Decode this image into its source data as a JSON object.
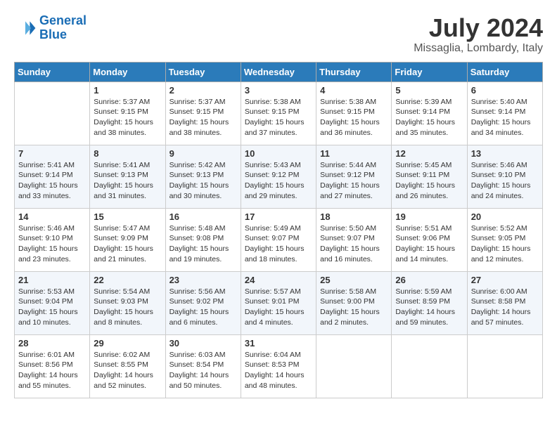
{
  "header": {
    "logo_line1": "General",
    "logo_line2": "Blue",
    "month_year": "July 2024",
    "location": "Missaglia, Lombardy, Italy"
  },
  "weekdays": [
    "Sunday",
    "Monday",
    "Tuesday",
    "Wednesday",
    "Thursday",
    "Friday",
    "Saturday"
  ],
  "weeks": [
    [
      {
        "day": "",
        "info": ""
      },
      {
        "day": "1",
        "info": "Sunrise: 5:37 AM\nSunset: 9:15 PM\nDaylight: 15 hours\nand 38 minutes."
      },
      {
        "day": "2",
        "info": "Sunrise: 5:37 AM\nSunset: 9:15 PM\nDaylight: 15 hours\nand 38 minutes."
      },
      {
        "day": "3",
        "info": "Sunrise: 5:38 AM\nSunset: 9:15 PM\nDaylight: 15 hours\nand 37 minutes."
      },
      {
        "day": "4",
        "info": "Sunrise: 5:38 AM\nSunset: 9:15 PM\nDaylight: 15 hours\nand 36 minutes."
      },
      {
        "day": "5",
        "info": "Sunrise: 5:39 AM\nSunset: 9:14 PM\nDaylight: 15 hours\nand 35 minutes."
      },
      {
        "day": "6",
        "info": "Sunrise: 5:40 AM\nSunset: 9:14 PM\nDaylight: 15 hours\nand 34 minutes."
      }
    ],
    [
      {
        "day": "7",
        "info": "Sunrise: 5:41 AM\nSunset: 9:14 PM\nDaylight: 15 hours\nand 33 minutes."
      },
      {
        "day": "8",
        "info": "Sunrise: 5:41 AM\nSunset: 9:13 PM\nDaylight: 15 hours\nand 31 minutes."
      },
      {
        "day": "9",
        "info": "Sunrise: 5:42 AM\nSunset: 9:13 PM\nDaylight: 15 hours\nand 30 minutes."
      },
      {
        "day": "10",
        "info": "Sunrise: 5:43 AM\nSunset: 9:12 PM\nDaylight: 15 hours\nand 29 minutes."
      },
      {
        "day": "11",
        "info": "Sunrise: 5:44 AM\nSunset: 9:12 PM\nDaylight: 15 hours\nand 27 minutes."
      },
      {
        "day": "12",
        "info": "Sunrise: 5:45 AM\nSunset: 9:11 PM\nDaylight: 15 hours\nand 26 minutes."
      },
      {
        "day": "13",
        "info": "Sunrise: 5:46 AM\nSunset: 9:10 PM\nDaylight: 15 hours\nand 24 minutes."
      }
    ],
    [
      {
        "day": "14",
        "info": "Sunrise: 5:46 AM\nSunset: 9:10 PM\nDaylight: 15 hours\nand 23 minutes."
      },
      {
        "day": "15",
        "info": "Sunrise: 5:47 AM\nSunset: 9:09 PM\nDaylight: 15 hours\nand 21 minutes."
      },
      {
        "day": "16",
        "info": "Sunrise: 5:48 AM\nSunset: 9:08 PM\nDaylight: 15 hours\nand 19 minutes."
      },
      {
        "day": "17",
        "info": "Sunrise: 5:49 AM\nSunset: 9:07 PM\nDaylight: 15 hours\nand 18 minutes."
      },
      {
        "day": "18",
        "info": "Sunrise: 5:50 AM\nSunset: 9:07 PM\nDaylight: 15 hours\nand 16 minutes."
      },
      {
        "day": "19",
        "info": "Sunrise: 5:51 AM\nSunset: 9:06 PM\nDaylight: 15 hours\nand 14 minutes."
      },
      {
        "day": "20",
        "info": "Sunrise: 5:52 AM\nSunset: 9:05 PM\nDaylight: 15 hours\nand 12 minutes."
      }
    ],
    [
      {
        "day": "21",
        "info": "Sunrise: 5:53 AM\nSunset: 9:04 PM\nDaylight: 15 hours\nand 10 minutes."
      },
      {
        "day": "22",
        "info": "Sunrise: 5:54 AM\nSunset: 9:03 PM\nDaylight: 15 hours\nand 8 minutes."
      },
      {
        "day": "23",
        "info": "Sunrise: 5:56 AM\nSunset: 9:02 PM\nDaylight: 15 hours\nand 6 minutes."
      },
      {
        "day": "24",
        "info": "Sunrise: 5:57 AM\nSunset: 9:01 PM\nDaylight: 15 hours\nand 4 minutes."
      },
      {
        "day": "25",
        "info": "Sunrise: 5:58 AM\nSunset: 9:00 PM\nDaylight: 15 hours\nand 2 minutes."
      },
      {
        "day": "26",
        "info": "Sunrise: 5:59 AM\nSunset: 8:59 PM\nDaylight: 14 hours\nand 59 minutes."
      },
      {
        "day": "27",
        "info": "Sunrise: 6:00 AM\nSunset: 8:58 PM\nDaylight: 14 hours\nand 57 minutes."
      }
    ],
    [
      {
        "day": "28",
        "info": "Sunrise: 6:01 AM\nSunset: 8:56 PM\nDaylight: 14 hours\nand 55 minutes."
      },
      {
        "day": "29",
        "info": "Sunrise: 6:02 AM\nSunset: 8:55 PM\nDaylight: 14 hours\nand 52 minutes."
      },
      {
        "day": "30",
        "info": "Sunrise: 6:03 AM\nSunset: 8:54 PM\nDaylight: 14 hours\nand 50 minutes."
      },
      {
        "day": "31",
        "info": "Sunrise: 6:04 AM\nSunset: 8:53 PM\nDaylight: 14 hours\nand 48 minutes."
      },
      {
        "day": "",
        "info": ""
      },
      {
        "day": "",
        "info": ""
      },
      {
        "day": "",
        "info": ""
      }
    ]
  ]
}
